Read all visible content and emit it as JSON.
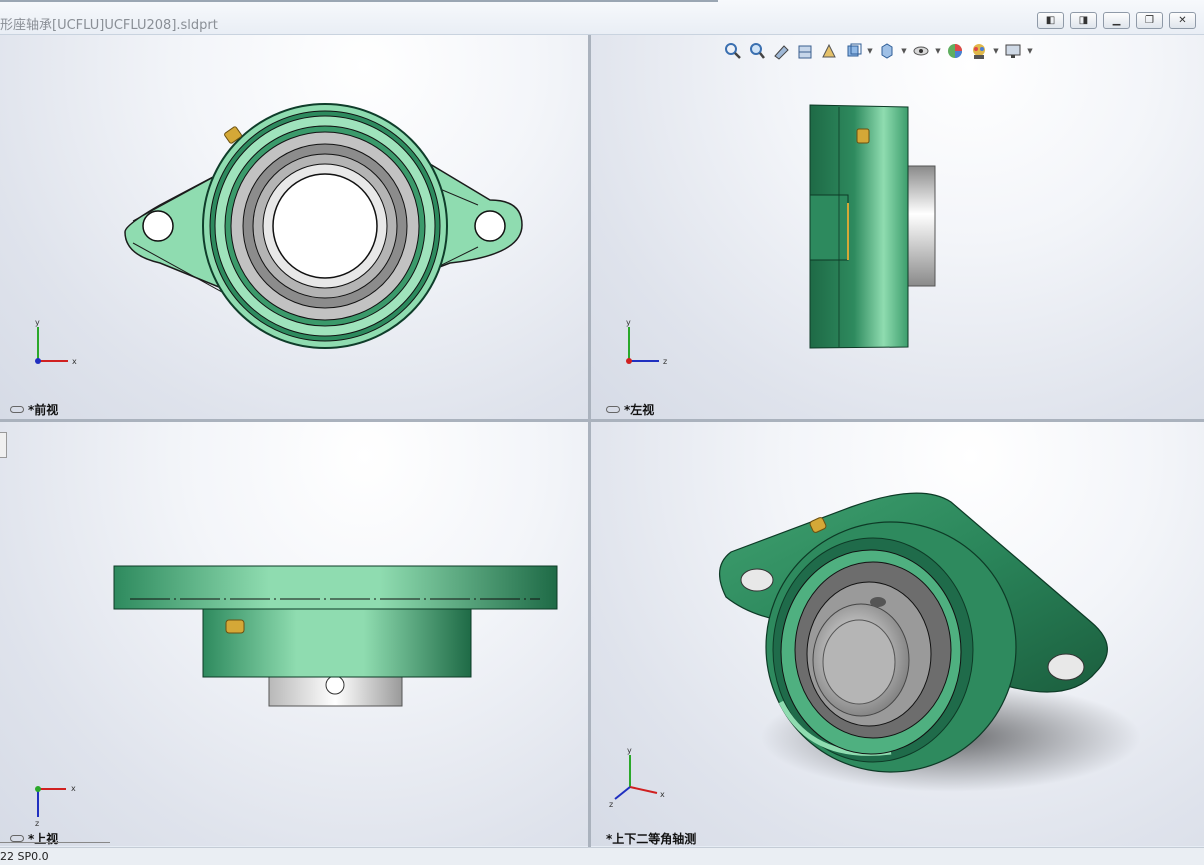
{
  "window": {
    "title": "形座轴承[UCFLU]UCFLU208].sldprt",
    "buttons": [
      "tile-vertical",
      "tile-horizontal",
      "minimize",
      "restore",
      "close"
    ]
  },
  "viewports": [
    {
      "id": "front",
      "label": "*前视",
      "axes": {
        "h": "x",
        "v": "y"
      }
    },
    {
      "id": "left",
      "label": "*左视",
      "axes": {
        "h": "z",
        "v": "y"
      }
    },
    {
      "id": "top",
      "label": "*上视",
      "axes": {
        "h": "x",
        "v": "z"
      }
    },
    {
      "id": "iso",
      "label": "*上下二等角轴测",
      "axes": {
        "h": "x",
        "v": "y",
        "d": "z"
      }
    }
  ],
  "heads_up_toolbar": {
    "items": [
      "zoom-to-fit-icon",
      "zoom-to-area-icon",
      "previous-view-icon",
      "section-view-icon",
      "view-orientation-icon",
      "display-style-icon",
      "hide-show-items-icon",
      "edit-appearance-icon",
      "apply-scene-icon",
      "view-settings-icon"
    ]
  },
  "colors": {
    "part_green": "#8fdcb0",
    "part_dark_green": "#1f6b4a",
    "bearing_gray": "#9c9c9c",
    "grease_fitting": "#d4a837"
  },
  "statusbar": {
    "text": "22 SP0.0"
  }
}
